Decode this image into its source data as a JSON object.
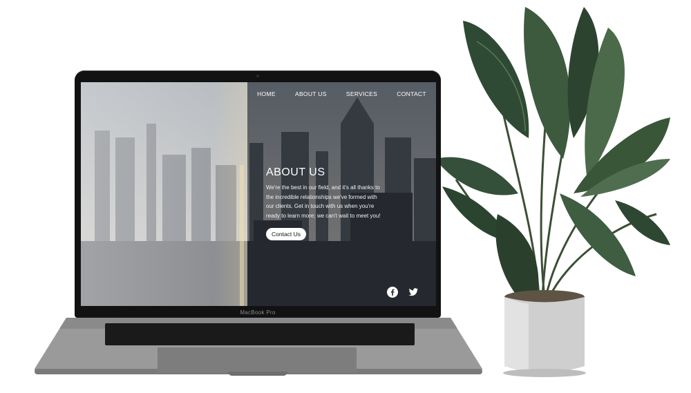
{
  "laptop": {
    "model_label": "MacBook Pro"
  },
  "site": {
    "nav": [
      {
        "label": "HOME"
      },
      {
        "label": "ABOUT US"
      },
      {
        "label": "SERVICES"
      },
      {
        "label": "CONTACT"
      }
    ],
    "about": {
      "title": "ABOUT US",
      "body": "We're the best in our field, and it's all thanks to the incredible relationships we've formed with our clients. Get in touch with us when you're ready to learn more; we can't wait to meet you!",
      "cta_label": "Contact Us"
    },
    "social": [
      {
        "icon": "facebook-icon"
      },
      {
        "icon": "twitter-icon"
      }
    ]
  },
  "colors": {
    "bezel": "#121212",
    "aluminum": "#8d8d8d",
    "leaf_dark": "#2f4a34",
    "leaf_mid": "#4f6e4f",
    "pot": "#cfcfcf"
  }
}
